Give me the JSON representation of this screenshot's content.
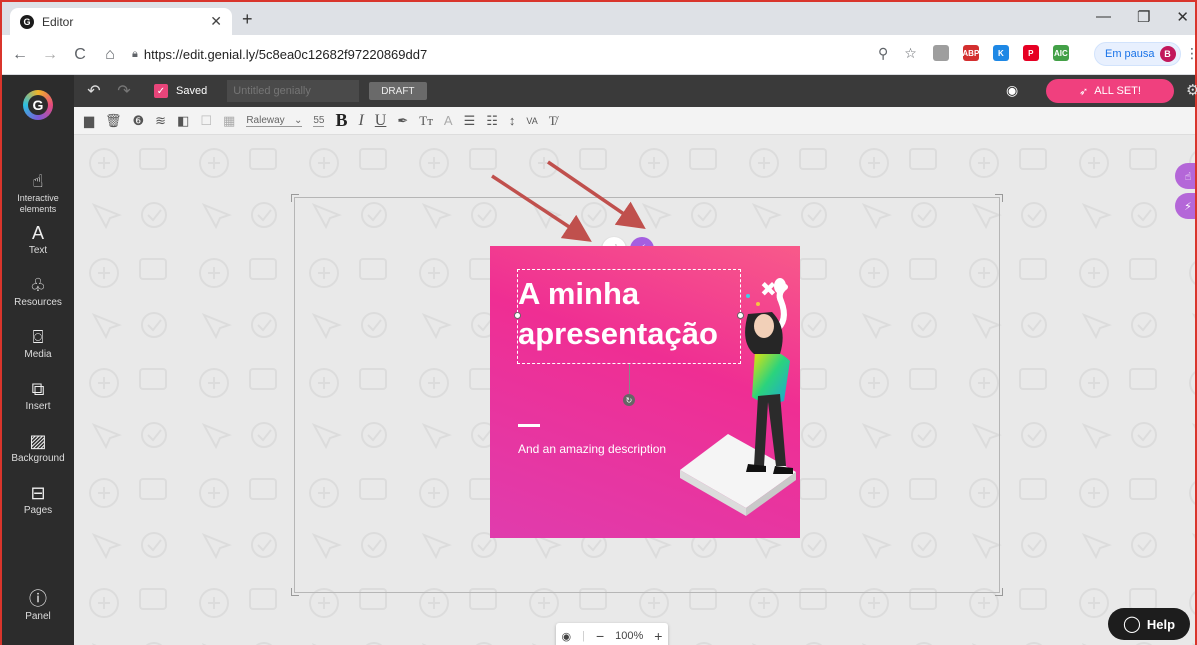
{
  "browser": {
    "tab_title": "Editor",
    "url": "https://edit.genial.ly/5c8ea0c12682f97220869dd7",
    "profile_status": "Em pausa",
    "profile_initial": "B",
    "extensions": [
      {
        "name": "cloud-ext",
        "label": "",
        "color": "#9e9e9e"
      },
      {
        "name": "adblock-ext",
        "label": "ABP",
        "color": "#d32f2f"
      },
      {
        "name": "k-ext",
        "label": "K",
        "color": "#1e88e5"
      },
      {
        "name": "pinterest-ext",
        "label": "P",
        "color": "#e60023"
      },
      {
        "name": "android-ext",
        "label": "AIC",
        "color": "#43a047"
      }
    ]
  },
  "app": {
    "saved_label": "Saved",
    "title_placeholder": "Untitled genially",
    "draft_label": "DRAFT",
    "all_set_label": "ALL SET!",
    "accent": "#f0407e"
  },
  "format_toolbar": {
    "font": "Raleway",
    "size": "55",
    "text_glyphs": [
      "B",
      "I",
      "U"
    ]
  },
  "sidebar": {
    "items": [
      {
        "id": "interactive",
        "label": "Interactive elements",
        "icon": "pointer-icon"
      },
      {
        "id": "text",
        "label": "Text",
        "icon": "text-icon"
      },
      {
        "id": "resources",
        "label": "Resources",
        "icon": "shapes-icon"
      },
      {
        "id": "media",
        "label": "Media",
        "icon": "camera-icon"
      },
      {
        "id": "insert",
        "label": "Insert",
        "icon": "insert-icon"
      },
      {
        "id": "background",
        "label": "Background",
        "icon": "hatch-icon"
      },
      {
        "id": "pages",
        "label": "Pages",
        "icon": "pages-icon"
      }
    ],
    "panel_label": "Panel"
  },
  "slide": {
    "title_line1": "A minha",
    "title_line2": "apresentação",
    "description": "And an amazing description"
  },
  "zoom": {
    "level": "100%"
  },
  "help_label": "Help"
}
